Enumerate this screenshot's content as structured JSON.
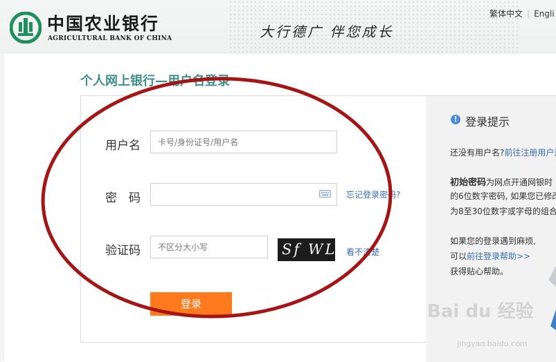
{
  "header": {
    "brand_cn": "中国农业银行",
    "brand_en": "AGRICULTURAL BANK OF CHINA",
    "slogan": "大行德广 伴您成长",
    "lang_traditional": "繁体中文",
    "lang_english": "Engli"
  },
  "page_title": "个人网上银行—用户名登录",
  "form": {
    "username_label": "用户名",
    "username_placeholder": "卡号/身份证号/用户名",
    "password_label": "密　码",
    "forgot_password": "忘记登录密码?",
    "captcha_label": "验证码",
    "captcha_placeholder": "不区分大小写",
    "captcha_text": "Sf WL",
    "captcha_refresh": "看不清楚",
    "login_button": "登录"
  },
  "side": {
    "title": "登录提示",
    "no_user_prefix": "还没有用户名?",
    "no_user_link": "前往注册用户通",
    "init_pwd_bold": "初始密码",
    "init_pwd_text1": "为网点开通网银时",
    "init_pwd_text2": "的6位数字密码, 如果您已修改",
    "init_pwd_text3": "为8至30位数字或字母的组合",
    "trouble_line1": "如果您的登录遇到麻烦,",
    "trouble_prefix": "可以",
    "trouble_link": "前往登录帮助>>",
    "trouble_line3": "获得贴心帮助。"
  },
  "watermark": {
    "main": "Bai du 经验",
    "sub": "jingyan.baidu.com"
  },
  "colors": {
    "title_teal": "#3f8f8b",
    "button_orange": "#ff7a1c",
    "link_blue": "#3a6fa8",
    "annotation_red": "#a51515"
  }
}
